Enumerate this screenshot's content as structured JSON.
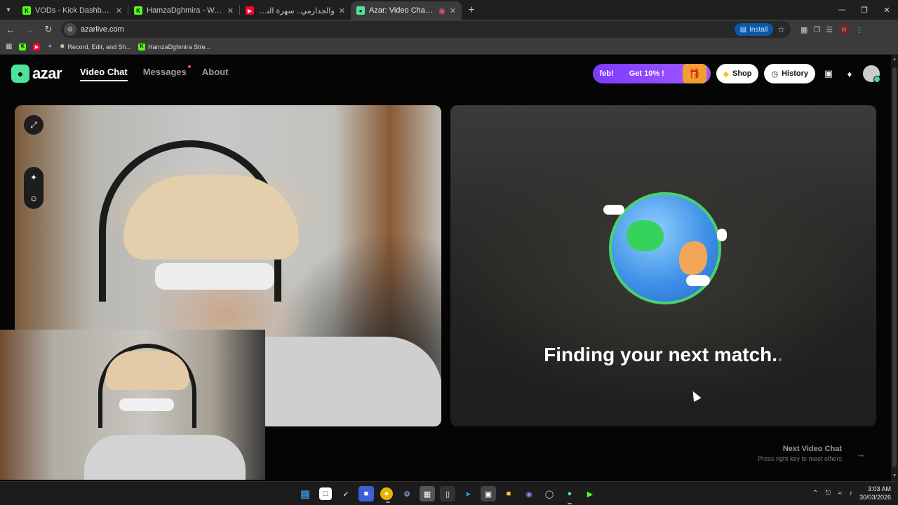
{
  "browser": {
    "tabs": [
      {
        "title": "VODs - Kick Dashboard",
        "favicon": "kick-icon",
        "color": "#53fc18",
        "active": false
      },
      {
        "title": "HamzaDghmira - Watch the VO",
        "favicon": "kick-icon",
        "color": "#53fc18",
        "active": false
      },
      {
        "title": "والجدارمي.. سهرة النشاط بامتياز",
        "favicon": "youtube-icon",
        "color": "#ff0033",
        "active": false
      },
      {
        "title": "Azar: Video Chat with New",
        "favicon": "azar-icon",
        "color": "#4de39a",
        "active": true
      }
    ],
    "url": "azarlive.com",
    "install_label": "Install",
    "bookmarks": [
      {
        "label": "",
        "icon": "kick-icon",
        "color": "#53fc18"
      },
      {
        "label": "",
        "icon": "youtube-icon",
        "color": "#ff0033"
      },
      {
        "label": "",
        "icon": "sparkle-icon",
        "color": "#7aa7ff"
      },
      {
        "label": "Record, Edit, and Sh...",
        "icon": "loom-icon",
        "color": "#cccccc"
      },
      {
        "label": "HamzaDghmira Stre...",
        "icon": "kick-icon",
        "color": "#53fc18"
      }
    ]
  },
  "site": {
    "logo_text": "azar",
    "nav": [
      {
        "label": "Video Chat",
        "active": true
      },
      {
        "label": "Messages",
        "active": false,
        "badge": true
      },
      {
        "label": "About",
        "active": false
      }
    ],
    "promo_left": "feb!",
    "promo_right": "Get 10% !",
    "shop_label": "Shop",
    "history_label": "History"
  },
  "match": {
    "status_text": "Finding your next match",
    "status_suffix": "."
  },
  "next_chat": {
    "title": "Next Video Chat",
    "hint": "Press right key to meet others"
  },
  "taskbar": {
    "time": "3:03 AM",
    "date": "30/03/2026"
  },
  "colors": {
    "azar_green": "#4de39a",
    "promo_purple": "#8a44ff",
    "online_dot": "#41d98a"
  }
}
